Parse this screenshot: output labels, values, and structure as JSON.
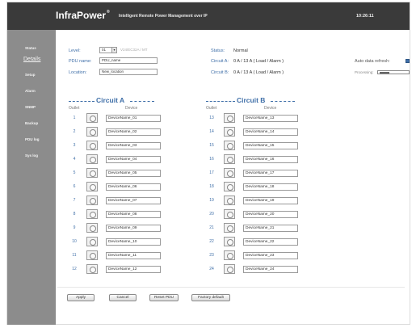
{
  "header": {
    "brand": "InfraPower",
    "brand_mark": "®",
    "tagline": "Intelligent Remote Power Management over IP",
    "clock": "10:26:11"
  },
  "sidebar": {
    "items": [
      {
        "label": "Status",
        "active": false
      },
      {
        "label": "Details",
        "active": true
      },
      {
        "label": "Setup",
        "active": false
      },
      {
        "label": "Alarm",
        "active": false
      },
      {
        "label": "SNMP",
        "active": false
      },
      {
        "label": "Backup",
        "active": false
      },
      {
        "label": "PDU log",
        "active": false
      },
      {
        "label": "Sys log",
        "active": false
      }
    ]
  },
  "info": {
    "level_label": "Level:",
    "level_value": "01",
    "model": "V24/EC32A / MT",
    "pdu_name_label": "PDU name:",
    "pdu_name_value": "PDU_name",
    "location_label": "Location:",
    "location_value": "New_location",
    "status_label": "Status:",
    "status_value": "Normal",
    "circuit_a_label": "Circuit A:",
    "circuit_a_value": "0 A / 13 A ( Load / Alarm )",
    "circuit_b_label": "Circuit B:",
    "circuit_b_value": "0 A / 13 A ( Load / Alarm )",
    "auto_refresh_label": "Auto data refresh:",
    "processing_label": "Processing:"
  },
  "circuits": [
    {
      "title": "Circuit A",
      "outlet_header": "Outlet",
      "device_header": "Device",
      "outlets": [
        {
          "num": "1",
          "device": "DeviceName_01"
        },
        {
          "num": "2",
          "device": "DeviceName_02"
        },
        {
          "num": "3",
          "device": "DeviceName_03"
        },
        {
          "num": "4",
          "device": "DeviceName_04"
        },
        {
          "num": "5",
          "device": "DeviceName_05"
        },
        {
          "num": "6",
          "device": "DeviceName_06"
        },
        {
          "num": "7",
          "device": "DeviceName_07"
        },
        {
          "num": "8",
          "device": "DeviceName_08"
        },
        {
          "num": "9",
          "device": "DeviceName_09"
        },
        {
          "num": "10",
          "device": "DeviceName_10"
        },
        {
          "num": "11",
          "device": "DeviceName_11"
        },
        {
          "num": "12",
          "device": "DeviceName_12"
        }
      ]
    },
    {
      "title": "Circuit B",
      "outlet_header": "Outlet",
      "device_header": "Device",
      "outlets": [
        {
          "num": "13",
          "device": "DeviceName_13"
        },
        {
          "num": "14",
          "device": "DeviceName_14"
        },
        {
          "num": "15",
          "device": "DeviceName_15"
        },
        {
          "num": "16",
          "device": "DeviceName_16"
        },
        {
          "num": "17",
          "device": "DeviceName_17"
        },
        {
          "num": "18",
          "device": "DeviceName_18"
        },
        {
          "num": "19",
          "device": "DeviceName_19"
        },
        {
          "num": "20",
          "device": "DeviceName_20"
        },
        {
          "num": "21",
          "device": "DeviceName_21"
        },
        {
          "num": "22",
          "device": "DeviceName_22"
        },
        {
          "num": "23",
          "device": "DeviceName_23"
        },
        {
          "num": "24",
          "device": "DeviceName_24"
        }
      ]
    }
  ],
  "buttons": {
    "apply": "Apply",
    "cancel": "Cancel",
    "reset_pdu": "Reset PDU",
    "factory_default": "Factory default"
  },
  "colors": {
    "header_bg": "#3a3a3a",
    "sidebar_bg": "#8c8c8c",
    "accent": "#3f6fa8"
  }
}
